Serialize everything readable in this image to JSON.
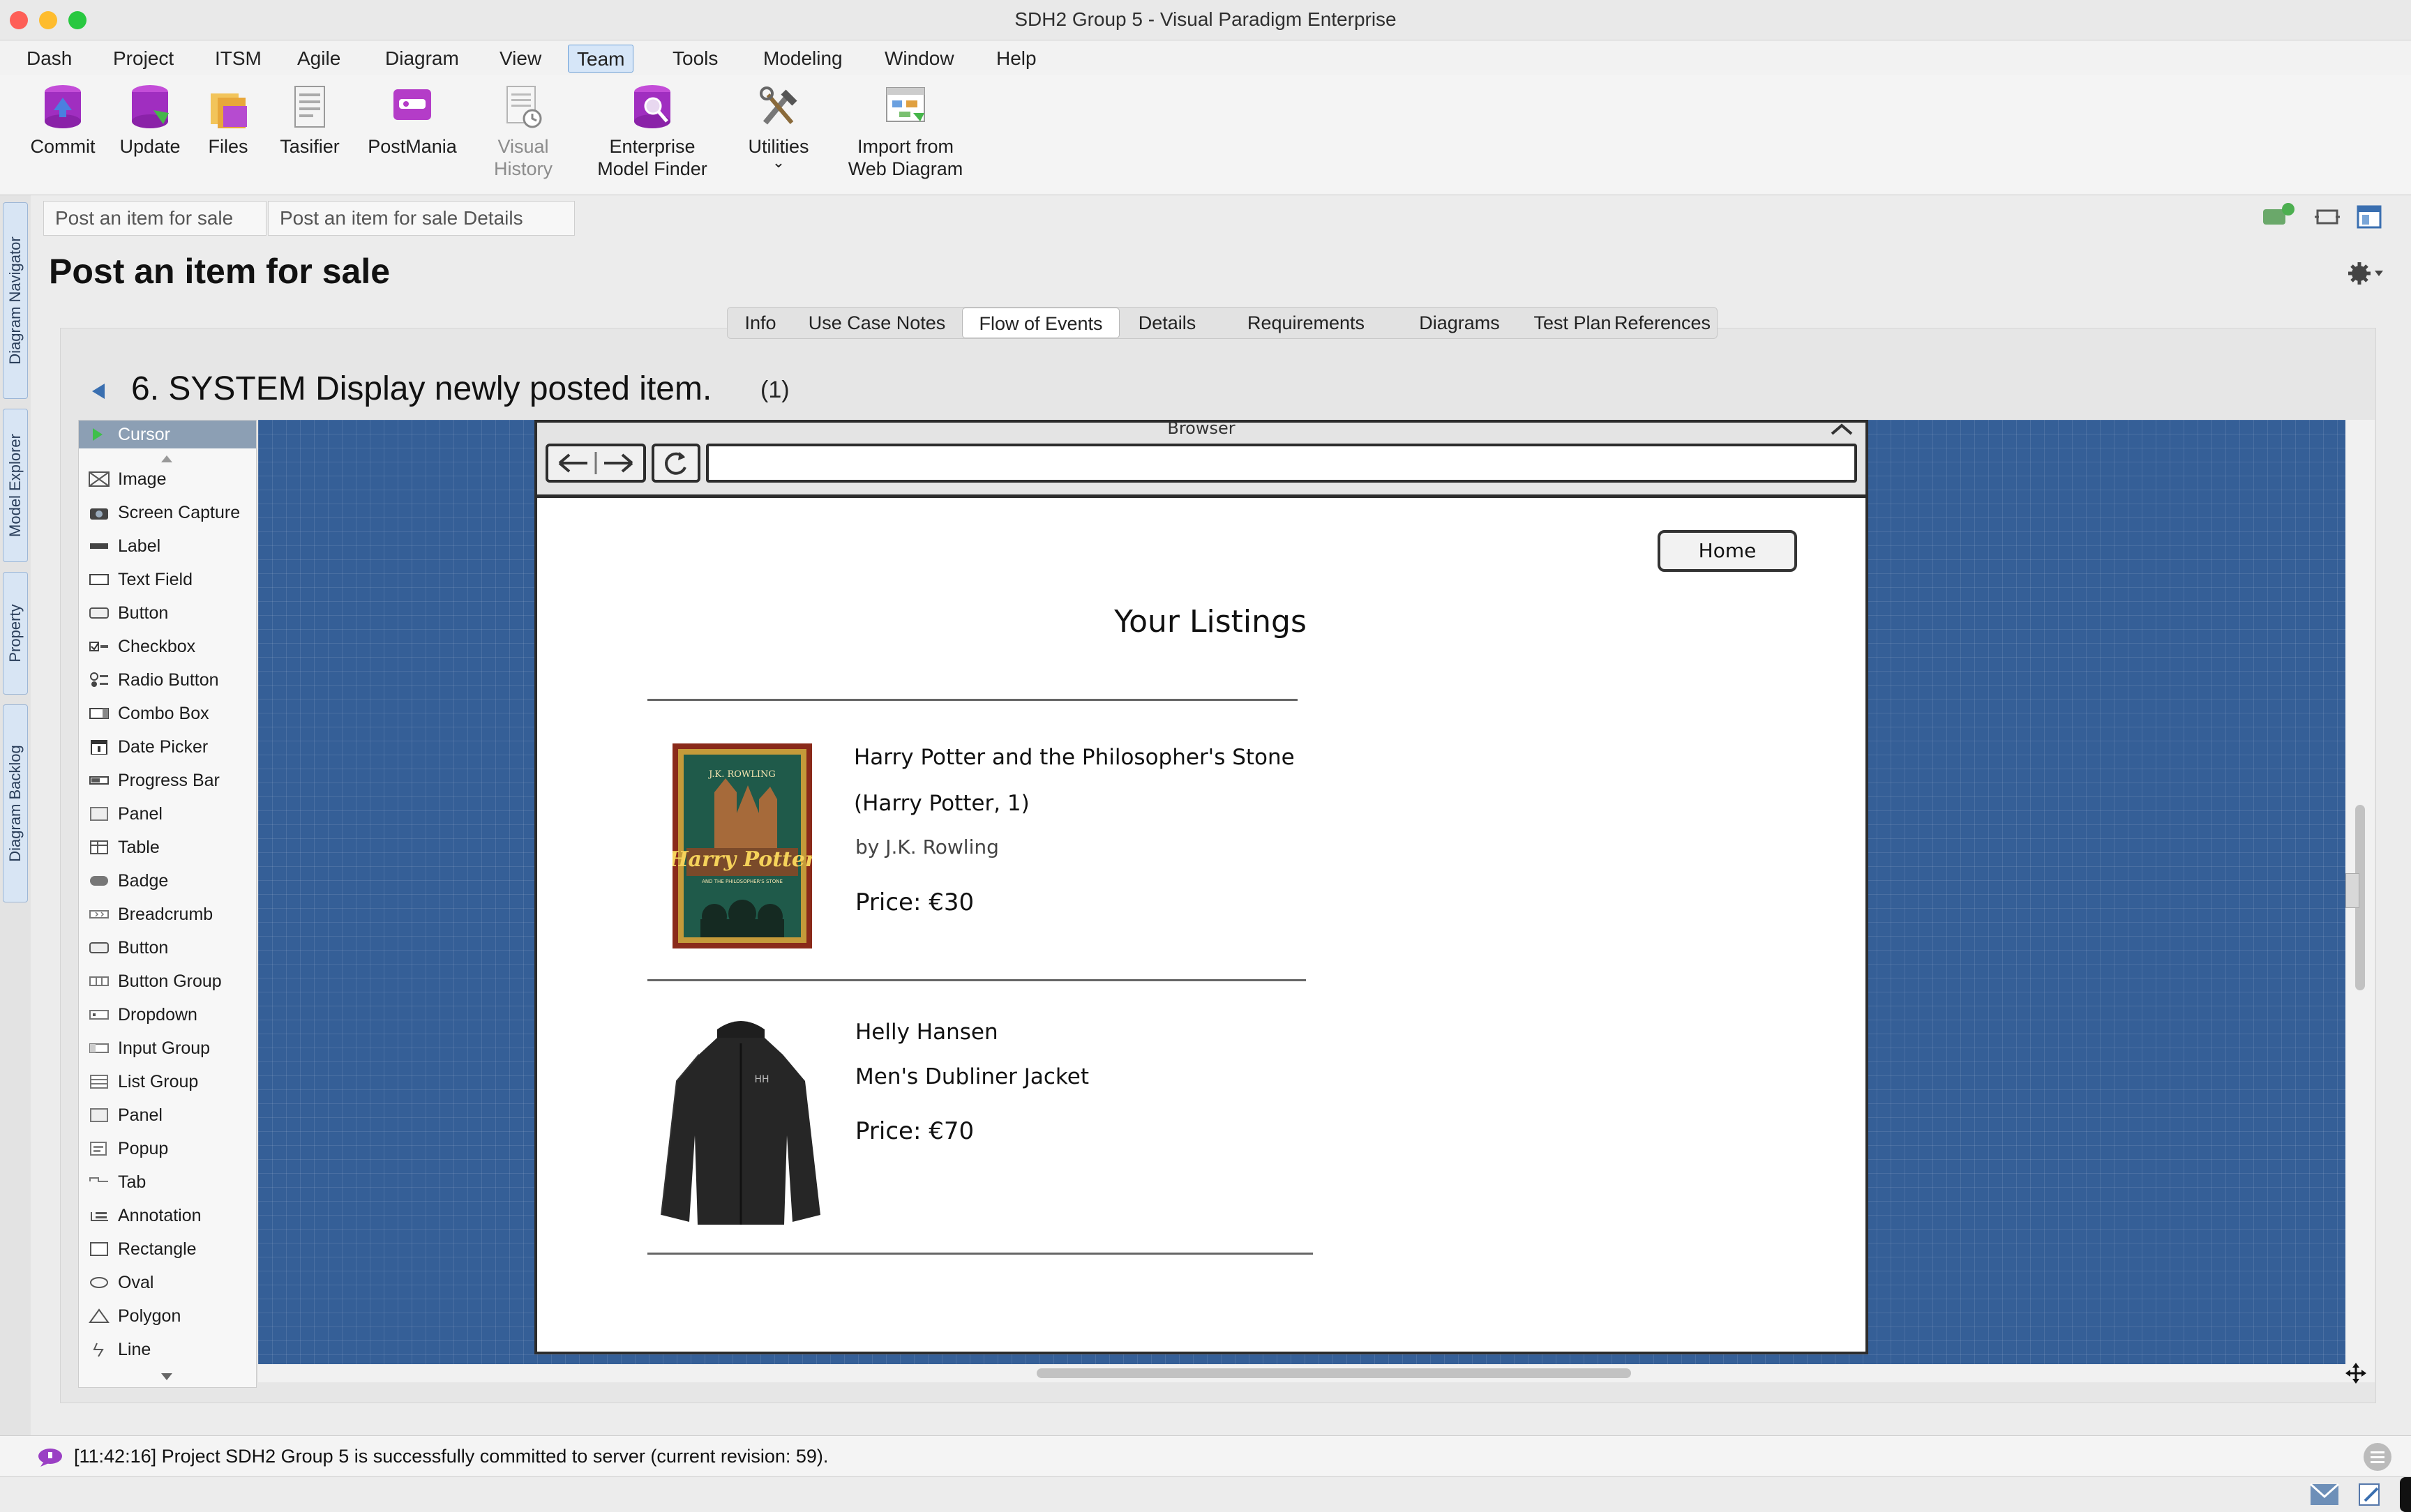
{
  "window": {
    "title": "SDH2 Group 5 - Visual Paradigm Enterprise",
    "colors": {
      "close": "#fe5f57",
      "minimize": "#febc2e",
      "maximize": "#28c840",
      "canvas": "#355f97",
      "accent": "#6a9fd8"
    }
  },
  "menu": [
    "Dash",
    "Project",
    "ITSM",
    "Agile",
    "Diagram",
    "View",
    "Team",
    "Tools",
    "Modeling",
    "Window",
    "Help"
  ],
  "menu_active": "Team",
  "ribbon": [
    {
      "label": "Commit",
      "icon": "commit-icon"
    },
    {
      "label": "Update",
      "icon": "update-icon"
    },
    {
      "label": "Files",
      "icon": "files-icon"
    },
    {
      "label": "Tasifier",
      "icon": "tasifier-icon"
    },
    {
      "label": "PostMania",
      "icon": "postmania-icon"
    },
    {
      "label1": "Visual",
      "label2": "History",
      "icon": "visual-history-icon"
    },
    {
      "label1": "Enterprise",
      "label2": "Model Finder",
      "icon": "model-finder-icon"
    },
    {
      "label": "Utilities",
      "icon": "utilities-icon",
      "dropdown": "⌄"
    },
    {
      "label1": "Import from",
      "label2": "Web Diagram",
      "icon": "import-web-icon"
    }
  ],
  "left_tabs": [
    "Diagram Navigator",
    "Model Explorer",
    "Property",
    "Diagram Backlog"
  ],
  "breadcrumb": [
    "Post an item for sale",
    "Post an item for sale Details"
  ],
  "page_title": "Post an item for sale",
  "tabs": [
    "Info",
    "Use Case Notes",
    "Flow of Events",
    "Details",
    "Requirements",
    "Diagrams",
    "Test Plan",
    "References"
  ],
  "active_tab": "Flow of Events",
  "step": {
    "heading": "6. SYSTEM Display newly posted item.",
    "count": "(1)"
  },
  "palette": {
    "cursor": "Cursor",
    "items": [
      "Image",
      "Screen Capture",
      "Label",
      "Text Field",
      "Button",
      "Checkbox",
      "Radio Button",
      "Combo Box",
      "Date Picker",
      "Progress Bar",
      "Panel",
      "Table",
      "Badge",
      "Breadcrumb",
      "Button",
      "Button Group",
      "Dropdown",
      "Input Group",
      "List Group",
      "Panel",
      "Popup",
      "Tab",
      "Annotation",
      "Rectangle",
      "Oval",
      "Polygon",
      "Line"
    ]
  },
  "mockup": {
    "browser_label": "Browser",
    "home_button": "Home",
    "heading": "Your Listings",
    "listings": [
      {
        "title_line1": "Harry Potter and the Philosopher's Stone",
        "title_line2": "(Harry Potter, 1)",
        "author": "by J.K. Rowling",
        "price": "Price: €30"
      },
      {
        "title_line1": "Helly Hansen",
        "title_line2": "Men's Dubliner Jacket",
        "price": "Price: €70"
      }
    ],
    "book_cover_text": {
      "author": "J.K. ROWLING",
      "title": "Harry Potter",
      "subtitle": "AND THE PHILOSOPHER'S STONE"
    },
    "jacket_logo": "HH"
  },
  "status": {
    "message": "[11:42:16] Project SDH2 Group 5 is successfully committed to server (current revision: 59)."
  }
}
